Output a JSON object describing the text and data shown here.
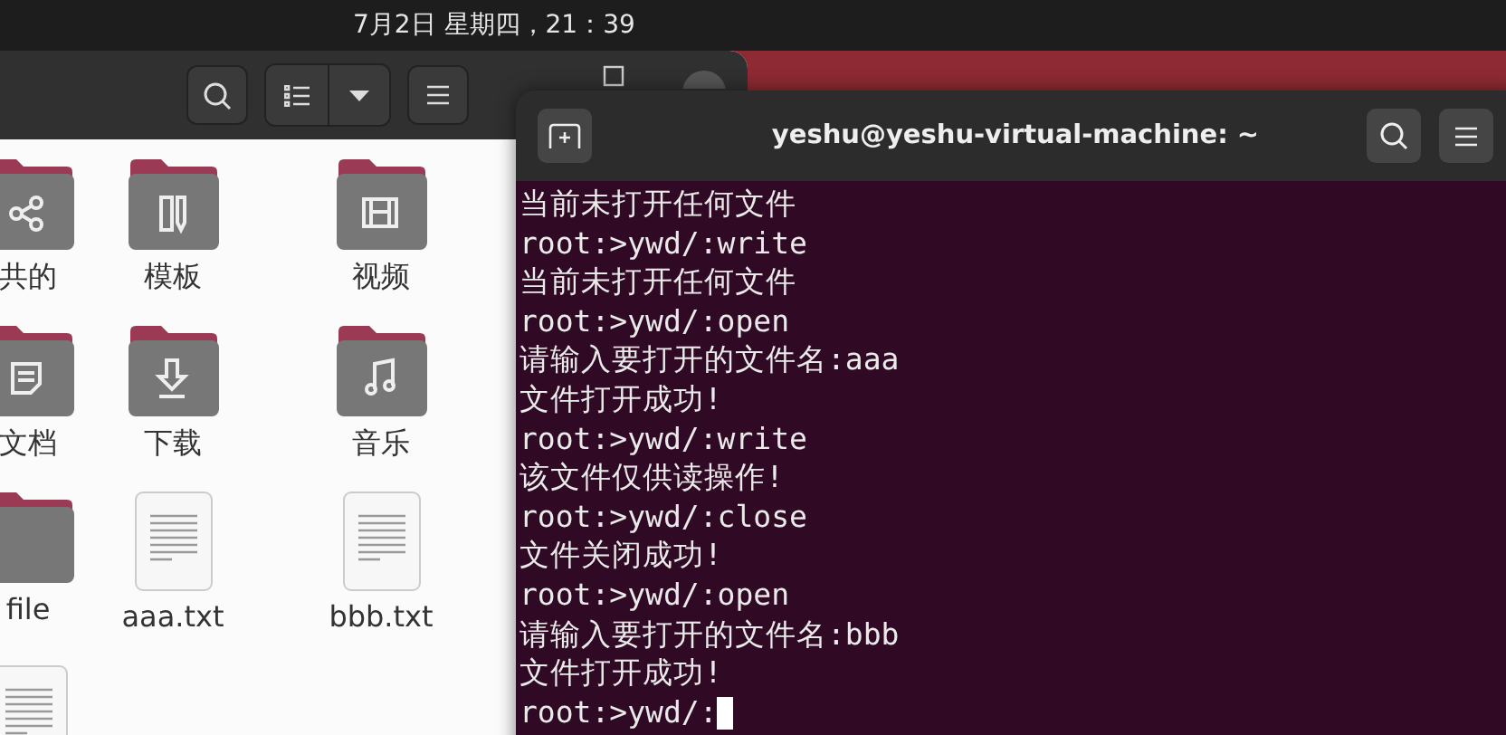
{
  "top_bar": {
    "clock": "7月2日 星期四，21：39"
  },
  "file_manager": {
    "files": [
      {
        "name": "共的",
        "kind": "shared"
      },
      {
        "name": "模板",
        "kind": "templates"
      },
      {
        "name": "视频",
        "kind": "videos"
      },
      {
        "name": "文档",
        "kind": "documents"
      },
      {
        "name": "下载",
        "kind": "downloads"
      },
      {
        "name": "音乐",
        "kind": "music"
      },
      {
        "name": "file",
        "kind": "folder"
      },
      {
        "name": "aaa.txt",
        "kind": "text"
      },
      {
        "name": "bbb.txt",
        "kind": "text"
      },
      {
        "kind": "text"
      }
    ]
  },
  "terminal": {
    "title": "yeshu@yeshu-virtual-machine: ~",
    "lines": [
      "当前未打开任何文件",
      "root:>ywd/:write",
      "当前未打开任何文件",
      "root:>ywd/:open",
      "请输入要打开的文件名:aaa",
      "文件打开成功!",
      "root:>ywd/:write",
      "该文件仅供读操作!",
      "root:>ywd/:close",
      "文件关闭成功!",
      "root:>ywd/:open",
      "请输入要打开的文件名:bbb",
      "文件打开成功!",
      "root:>ywd/:"
    ]
  }
}
